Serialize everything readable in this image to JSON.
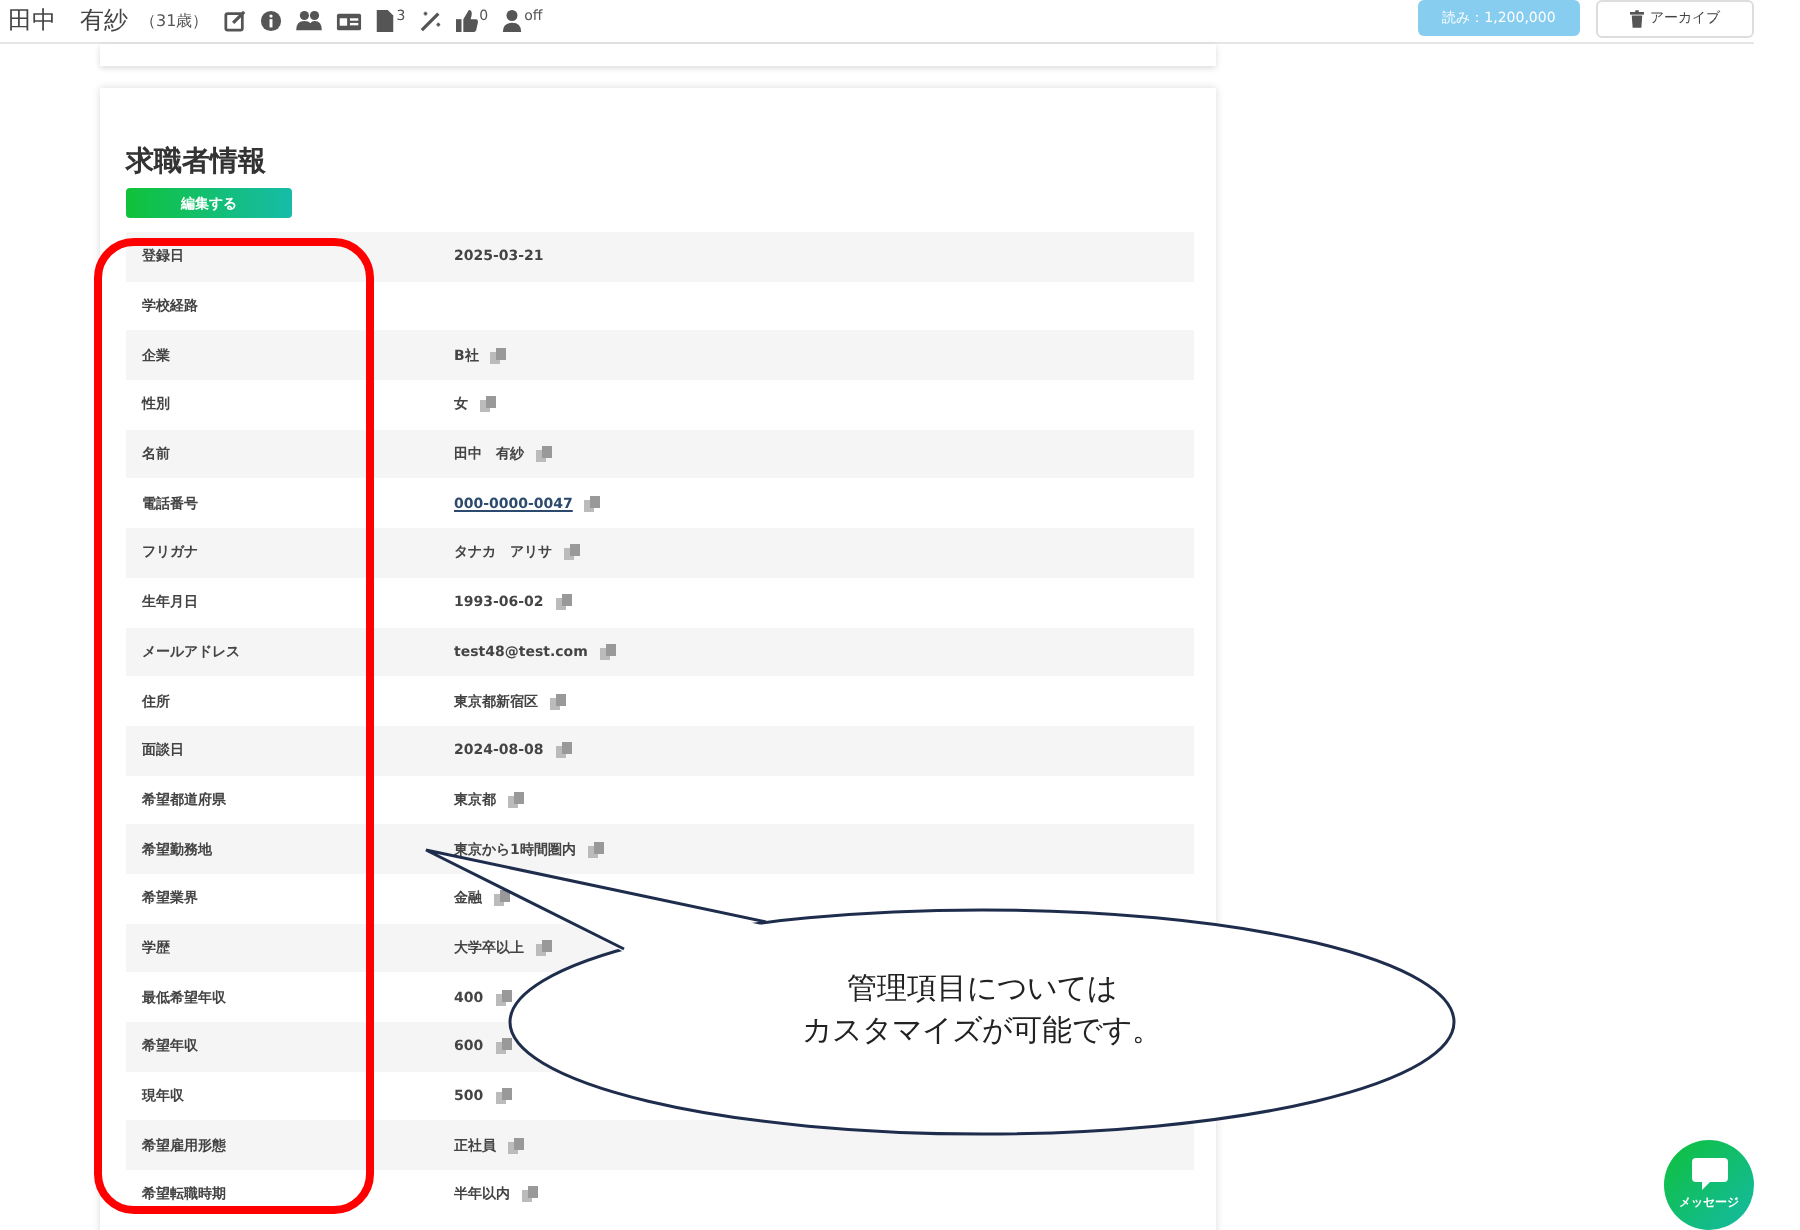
{
  "header": {
    "name": "田中　有紗",
    "age": "（31歳）",
    "icons": [
      {
        "kind": "edit"
      },
      {
        "kind": "info"
      },
      {
        "kind": "users"
      },
      {
        "kind": "card"
      },
      {
        "kind": "document",
        "sup": "3"
      },
      {
        "kind": "wand"
      },
      {
        "kind": "thumbs",
        "sup": "0"
      },
      {
        "kind": "person",
        "sup": "off"
      }
    ],
    "amount": "読み：1,200,000",
    "archive": "アーカイブ"
  },
  "section": {
    "title": "求職者情報",
    "edit_button": "編集する",
    "rows": [
      {
        "label": "登録日",
        "value": "2025-03-21",
        "kind": "plain"
      },
      {
        "label": "学校経路",
        "kind": "empty"
      },
      {
        "label": "企業",
        "value": "B社",
        "kind": "copy"
      },
      {
        "label": "性別",
        "value": "女",
        "kind": "copy"
      },
      {
        "label": "名前",
        "value": "田中　有紗",
        "kind": "copy"
      },
      {
        "label": "電話番号",
        "value": "000-0000-0047",
        "kind": "link"
      },
      {
        "label": "フリガナ",
        "value": "タナカ　アリサ",
        "kind": "copy"
      },
      {
        "label": "生年月日",
        "value": "1993-06-02",
        "kind": "copy"
      },
      {
        "label": "メールアドレス",
        "value": "test48@test.com",
        "kind": "copy"
      },
      {
        "label": "住所",
        "value": "東京都新宿区",
        "kind": "copy"
      },
      {
        "label": "面談日",
        "value": "2024-08-08",
        "kind": "copy"
      },
      {
        "label": "希望都道府県",
        "value": "東京都",
        "kind": "copy"
      },
      {
        "label": "希望勤務地",
        "value": "東京から1時間圏内",
        "kind": "copy"
      },
      {
        "label": "希望業界",
        "value": "金融",
        "kind": "copy"
      },
      {
        "label": "学歴",
        "value": "大学卒以上",
        "kind": "copy"
      },
      {
        "label": "最低希望年収",
        "value": "400",
        "kind": "copy"
      },
      {
        "label": "希望年収",
        "value": "600",
        "kind": "copy"
      },
      {
        "label": "現年収",
        "value": "500",
        "kind": "copy"
      },
      {
        "label": "希望雇用形態",
        "value": "正社員",
        "kind": "copy"
      },
      {
        "label": "希望転職時期",
        "value": "半年以内",
        "kind": "copy"
      }
    ]
  },
  "callout": {
    "lines": [
      "管理項目については",
      "カスタマイズが可能です。"
    ]
  },
  "chat_button": {
    "label": "メッセージ"
  }
}
